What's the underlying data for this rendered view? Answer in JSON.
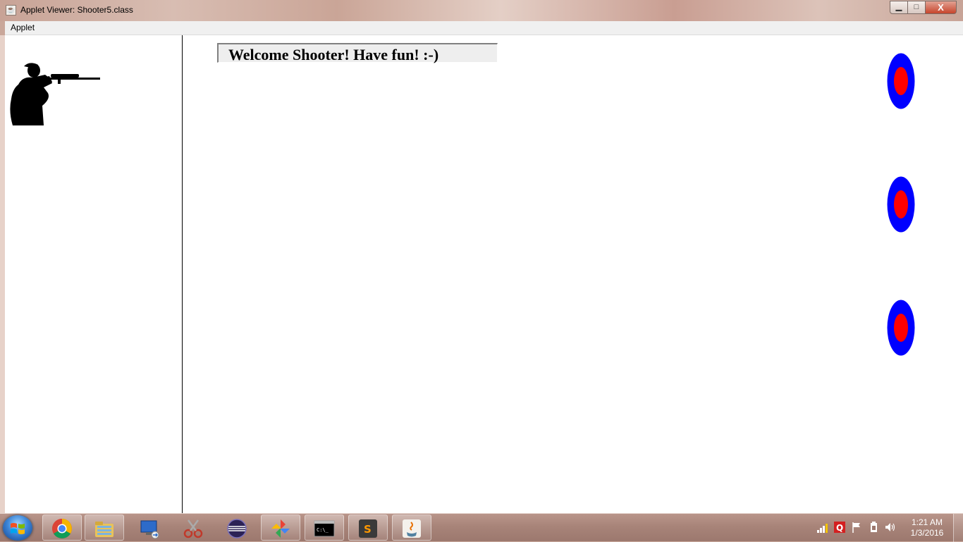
{
  "window": {
    "title": "Applet Viewer: Shooter5.class",
    "minimize_glyph": "▁",
    "maximize_glyph": "□",
    "close_glyph": "X"
  },
  "menu": {
    "items": [
      {
        "label": "Applet"
      }
    ]
  },
  "applet": {
    "banner": "Welcome Shooter! Have fun! :-)",
    "shooter_icon": "rifle-shooter-silhouette",
    "targets": [
      {
        "name": "target-1",
        "outer_color": "#0000ff",
        "inner_color": "#ff0000"
      },
      {
        "name": "target-2",
        "outer_color": "#0000ff",
        "inner_color": "#ff0000"
      },
      {
        "name": "target-3",
        "outer_color": "#0000ff",
        "inner_color": "#ff0000"
      }
    ]
  },
  "taskbar": {
    "start_icon": "windows-logo-icon",
    "apps": [
      {
        "name": "chrome-icon",
        "pinned": true
      },
      {
        "name": "file-explorer-icon",
        "pinned": true
      },
      {
        "name": "remote-desktop-icon",
        "pinned": true
      },
      {
        "name": "snipping-tool-icon",
        "pinned": true
      },
      {
        "name": "eclipse-icon",
        "pinned": true
      },
      {
        "name": "google-photos-icon",
        "pinned": true
      },
      {
        "name": "command-prompt-icon",
        "pinned": true
      },
      {
        "name": "sublime-text-icon",
        "pinned": true
      },
      {
        "name": "java-icon",
        "pinned": true
      }
    ],
    "tray_icons": [
      "network-signal-icon",
      "q-app-icon",
      "flag-icon",
      "power-icon",
      "volume-icon"
    ],
    "clock": {
      "time": "1:21 AM",
      "date": "1/3/2016"
    }
  },
  "colors": {
    "target_outer": "#0000ff",
    "target_inner": "#ff0000",
    "banner_bg": "#eeeeee"
  }
}
